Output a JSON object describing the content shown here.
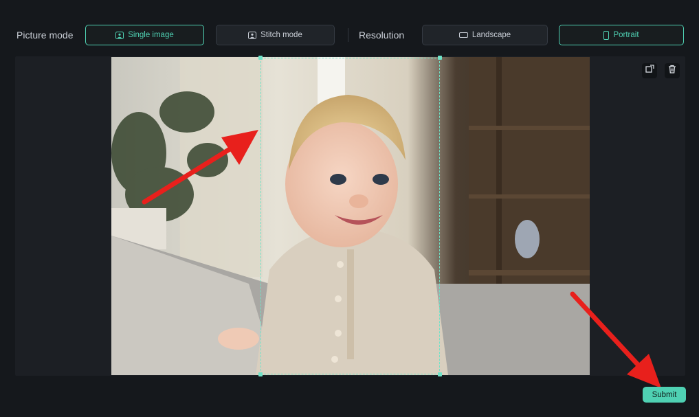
{
  "toolbar": {
    "picture_mode_label": "Picture mode",
    "single_image_label": "Single image",
    "stitch_mode_label": "Stitch mode",
    "resolution_label": "Resolution",
    "landscape_label": "Landscape",
    "portrait_label": "Portrait",
    "selected_picture_mode": "Single image",
    "selected_resolution": "Portrait"
  },
  "canvas": {
    "icons": [
      "replace-image-icon",
      "trash-icon"
    ]
  },
  "footer": {
    "submit_label": "Submit"
  },
  "colors": {
    "accent": "#4fd1b3",
    "background": "#15181c",
    "annotation_arrow": "#e8201c"
  }
}
